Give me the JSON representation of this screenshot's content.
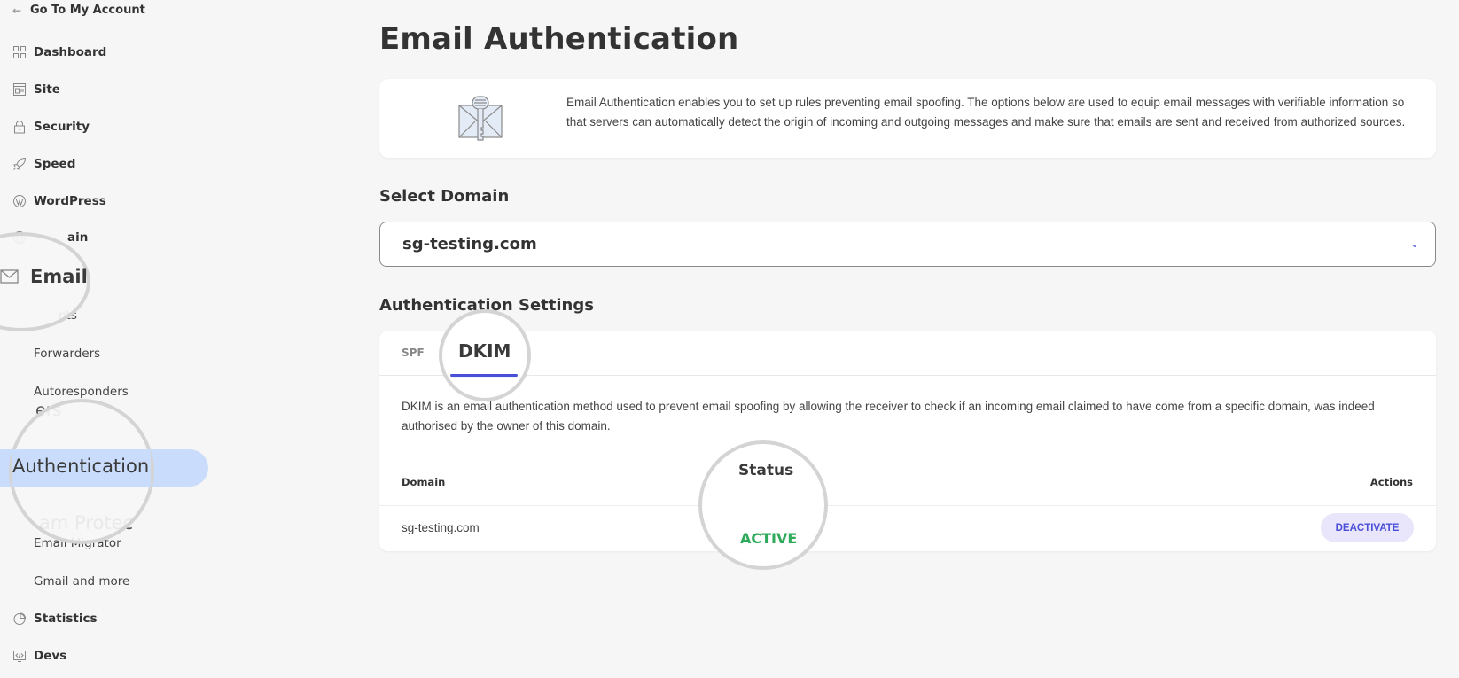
{
  "sidebar": {
    "back_label": "Go To My Account",
    "items": [
      {
        "label": "Dashboard",
        "icon": "grid-icon"
      },
      {
        "label": "Site",
        "icon": "site-icon"
      },
      {
        "label": "Security",
        "icon": "lock-icon"
      },
      {
        "label": "Speed",
        "icon": "rocket-icon"
      },
      {
        "label": "WordPress",
        "icon": "wordpress-icon"
      },
      {
        "label": "Domain",
        "icon": "globe-icon"
      },
      {
        "label": "Email",
        "icon": "envelope-icon"
      }
    ],
    "email_sub_items": [
      {
        "label": "Accounts"
      },
      {
        "label": "Forwarders"
      },
      {
        "label": "Autoresponders"
      },
      {
        "label": "Filters"
      },
      {
        "label": "Authentication"
      },
      {
        "label": "Spam Protection"
      },
      {
        "label": "Email Migrator"
      },
      {
        "label": "Gmail and more"
      }
    ],
    "bottom_items": [
      {
        "label": "Statistics",
        "icon": "pie-chart-icon"
      },
      {
        "label": "Devs",
        "icon": "code-icon"
      }
    ],
    "active_item": "Authentication",
    "partial_labels": {
      "domain_clipped": "ain",
      "accounts_clipped": "nts",
      "filters_clipped": "ers",
      "spam_clipped": "am Protec"
    }
  },
  "main": {
    "title": "Email Authentication",
    "intro": "Email Authentication enables you to set up rules preventing email spoofing. The options below are used to equip email messages with verifiable information so that servers can automatically detect the origin of incoming and outgoing messages and make sure that emails are sent and received from authorized sources.",
    "select_domain_label": "Select Domain",
    "selected_domain": "sg-testing.com",
    "settings_label": "Authentication Settings",
    "tabs": [
      {
        "label": "SPF",
        "active": false
      },
      {
        "label": "DKIM",
        "active": true
      }
    ],
    "dkim_description": "DKIM is an email authentication method used to prevent email spoofing by allowing the receiver to check if an incoming email claimed to have come from a specific domain, was indeed authorised by the owner of this domain.",
    "table": {
      "headers": {
        "domain": "Domain",
        "status": "Status",
        "actions": "Actions"
      },
      "rows": [
        {
          "domain": "sg-testing.com",
          "status": "ACTIVE",
          "action": "DEACTIVATE"
        }
      ]
    }
  },
  "colors": {
    "accent": "#4a4fd8",
    "active_pill": "#c9dcfb",
    "status_active": "#2eaa5a",
    "button_bg": "#e9e6fb"
  }
}
